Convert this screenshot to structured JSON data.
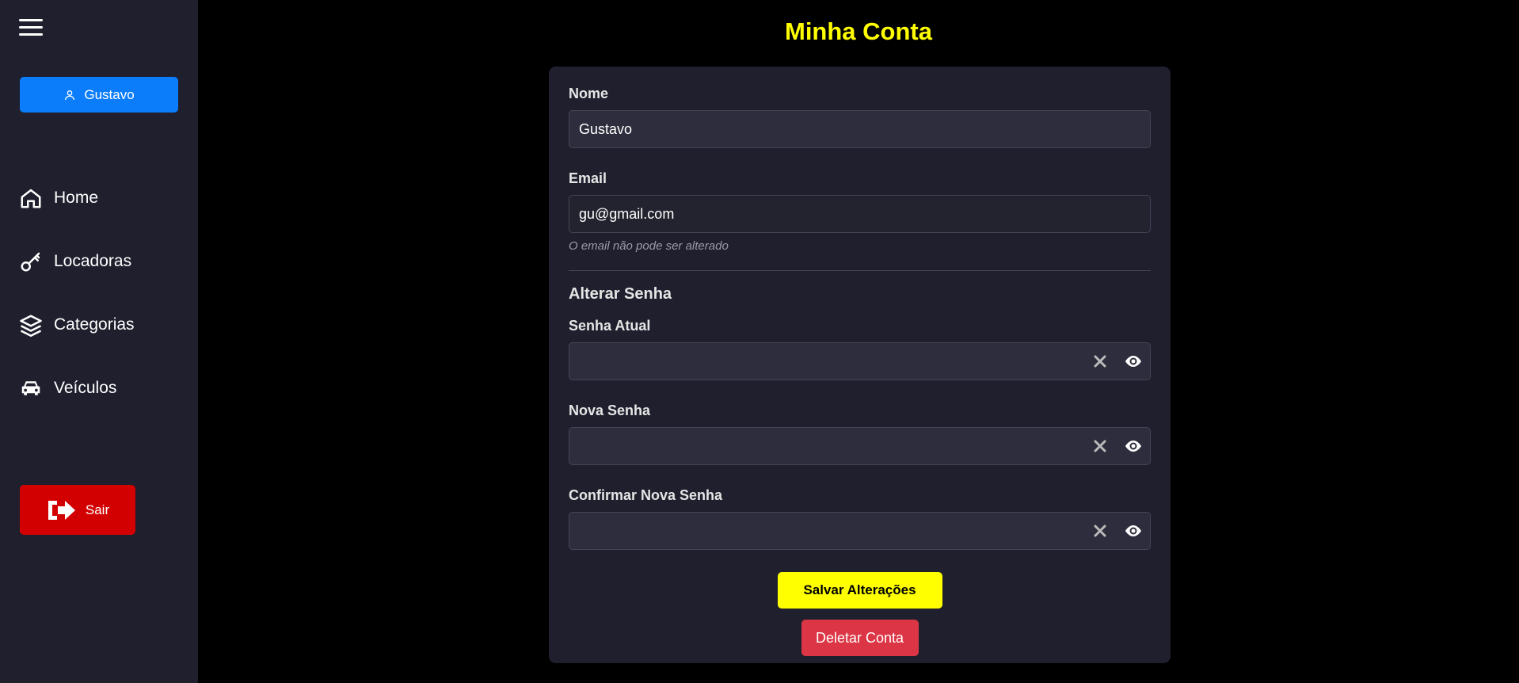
{
  "sidebar": {
    "menu_icon": "hamburger-icon",
    "user": {
      "label": "Gustavo",
      "icon": "user-icon"
    },
    "items": [
      {
        "label": "Home",
        "icon": "home-icon"
      },
      {
        "label": "Locadoras",
        "icon": "key-icon"
      },
      {
        "label": "Categorias",
        "icon": "layers-icon"
      },
      {
        "label": "Veículos",
        "icon": "car-icon"
      }
    ],
    "logout": {
      "label": "Sair",
      "icon": "sign-out-icon"
    }
  },
  "page": {
    "title": "Minha Conta"
  },
  "form": {
    "name": {
      "label": "Nome",
      "value": "Gustavo"
    },
    "email": {
      "label": "Email",
      "value": "gu@gmail.com",
      "hint": "O email não pode ser alterado"
    },
    "password_section": {
      "title": "Alterar Senha",
      "current": {
        "label": "Senha Atual",
        "value": ""
      },
      "new": {
        "label": "Nova Senha",
        "value": ""
      },
      "confirm": {
        "label": "Confirmar Nova Senha",
        "value": ""
      }
    },
    "save_label": "Salvar Alterações",
    "delete_label": "Deletar Conta"
  },
  "colors": {
    "accent_yellow": "#ffff00",
    "primary_blue": "#0b7dfb",
    "danger_red": "#d20000",
    "delete_red": "#dc3545",
    "panel": "#1f1f2e"
  }
}
